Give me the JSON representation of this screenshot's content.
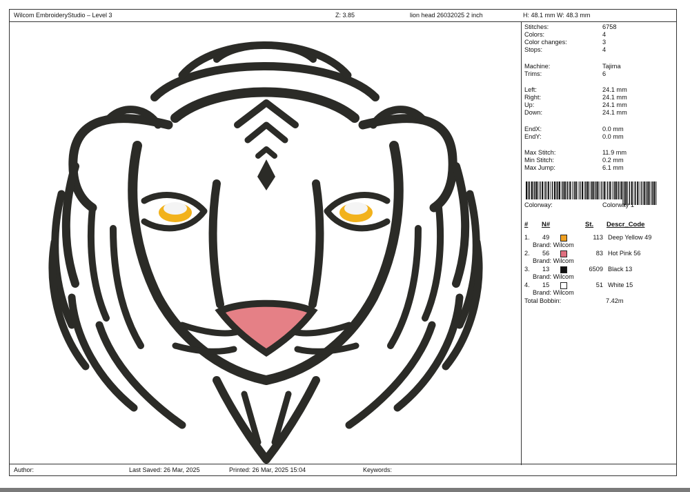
{
  "header": {
    "app_title": "Wilcom EmbroideryStudio – Level 3",
    "zoom": "Z: 3.85",
    "design_name": "lion head  26032025 2 inch",
    "dimensions": "H: 48.1 mm   W: 48.3 mm"
  },
  "stats": [
    {
      "label": "Stitches:",
      "value": "6758"
    },
    {
      "label": "Colors:",
      "value": "4"
    },
    {
      "label": "Color changes:",
      "value": "3"
    },
    {
      "label": "Stops:",
      "value": "4"
    },
    {
      "label": "Machine:",
      "value": "Tajima"
    },
    {
      "label": "Trims:",
      "value": "6"
    },
    {
      "label": "Left:",
      "value": "24.1 mm"
    },
    {
      "label": "Right:",
      "value": "24.1 mm"
    },
    {
      "label": "Up:",
      "value": "24.1 mm"
    },
    {
      "label": "Down:",
      "value": "24.1 mm"
    },
    {
      "label": "EndX:",
      "value": "0.0 mm"
    },
    {
      "label": "EndY:",
      "value": "0.0 mm"
    },
    {
      "label": "Max Stitch:",
      "value": "11.9 mm"
    },
    {
      "label": "Min Stitch:",
      "value": "0.2 mm"
    },
    {
      "label": "Max Jump:",
      "value": "6.1 mm"
    }
  ],
  "colorway": {
    "label": "Colorway:",
    "value": "Colorway 1"
  },
  "color_table": {
    "headers": {
      "idx": "#",
      "code": "N#",
      "stitches": "St.",
      "desc": "Descr_Code"
    },
    "rows": [
      {
        "idx": "1.",
        "code": "49",
        "swatch": "#f0a020",
        "stitches": "113",
        "desc": "Deep Yellow 49",
        "brand": "Brand: Wilcom"
      },
      {
        "idx": "2.",
        "code": "56",
        "swatch": "#e07080",
        "stitches": "83",
        "desc": "Hot Pink 56",
        "brand": "Brand: Wilcom"
      },
      {
        "idx": "3.",
        "code": "13",
        "swatch": "#111111",
        "stitches": "6509",
        "desc": "Black 13",
        "brand": "Brand: Wilcom"
      },
      {
        "idx": "4.",
        "code": "15",
        "swatch": "#ffffff",
        "stitches": "51",
        "desc": "White 15",
        "brand": "Brand: Wilcom"
      }
    ],
    "total_bobbin_label": "Total Bobbin:",
    "total_bobbin_value": "7.42m"
  },
  "footer": {
    "author": "Author:",
    "last_saved": "Last Saved: 26 Mar, 2025",
    "printed": "Printed: 26 Mar, 2025 15:04",
    "keywords": "Keywords:"
  },
  "colors": {
    "thread_black": "#2b2b27",
    "thread_yellow": "#f2b21c",
    "thread_pink": "#e58086",
    "thread_white": "#f4f4f4"
  }
}
